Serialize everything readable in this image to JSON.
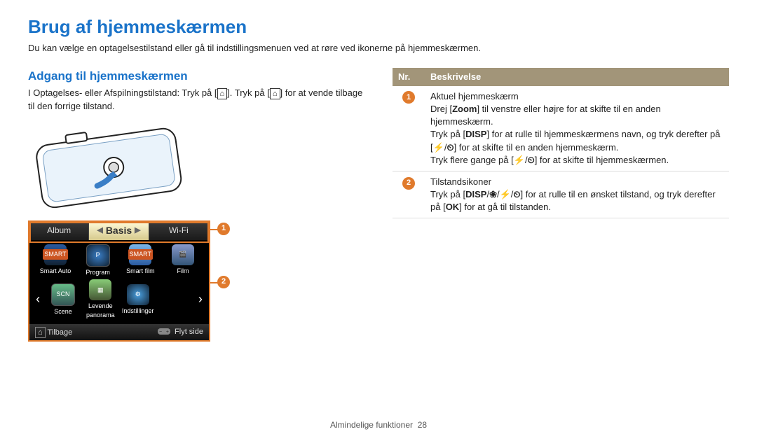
{
  "page_title": "Brug af hjemmeskærmen",
  "intro": "Du kan vælge en optagelsestilstand eller gå til indstillingsmenuen ved at røre ved ikonerne på hjemmeskærmen.",
  "section_title": "Adgang til hjemmeskærmen",
  "body_part1": "I Optagelses- eller Afspilningstilstand: Tryk på [",
  "home_glyph": "⌂",
  "body_part2": "]. Tryk på [",
  "body_part3": "] for at vende tilbage til den forrige tilstand.",
  "screen": {
    "tabs": {
      "left": "Album",
      "center": "Basis",
      "right": "Wi-Fi"
    },
    "row1": [
      {
        "label": "Smart Auto"
      },
      {
        "label": "Program"
      },
      {
        "label": "Smart film"
      },
      {
        "label": "Film"
      }
    ],
    "row2": [
      {
        "label": "Scene"
      },
      {
        "label": "Levende panorama"
      },
      {
        "label": "Indstillinger"
      }
    ],
    "bottom_left": "Tilbage",
    "bottom_left_glyph": "⌂",
    "bottom_right": "Flyt side",
    "callout1": "1",
    "callout2": "2"
  },
  "table": {
    "head_nr": "Nr.",
    "head_desc": "Beskrivelse",
    "r1_num": "1",
    "r1_line1": "Aktuel hjemmeskærm",
    "r1_line2a": "Drej [",
    "r1_zoom": "Zoom",
    "r1_line2b": "] til venstre eller højre for at skifte til en anden hjemmeskærm.",
    "r1_line3a": "Tryk på [",
    "r1_disp": "DISP",
    "r1_line3b": "] for at rulle til hjemmeskærmens navn, og tryk derefter på [",
    "r1_flash": "⚡",
    "r1_slash": "/",
    "r1_timer": "⏲",
    "r1_line3c": "] for at skifte til en anden hjemmeskærm.",
    "r1_line4a": "Tryk flere gange på [",
    "r1_line4b": "] for at skifte til hjemmeskærmen.",
    "r2_num": "2",
    "r2_line1": "Tilstandsikoner",
    "r2_line2a": "Tryk på [",
    "r2_macro": "❀",
    "r2_line2b": "] for at rulle til en ønsket tilstand, og tryk derefter på [",
    "r2_ok": "OK",
    "r2_line2c": "] for at gå til tilstanden."
  },
  "footer_section": "Almindelige funktioner",
  "footer_page": "28"
}
